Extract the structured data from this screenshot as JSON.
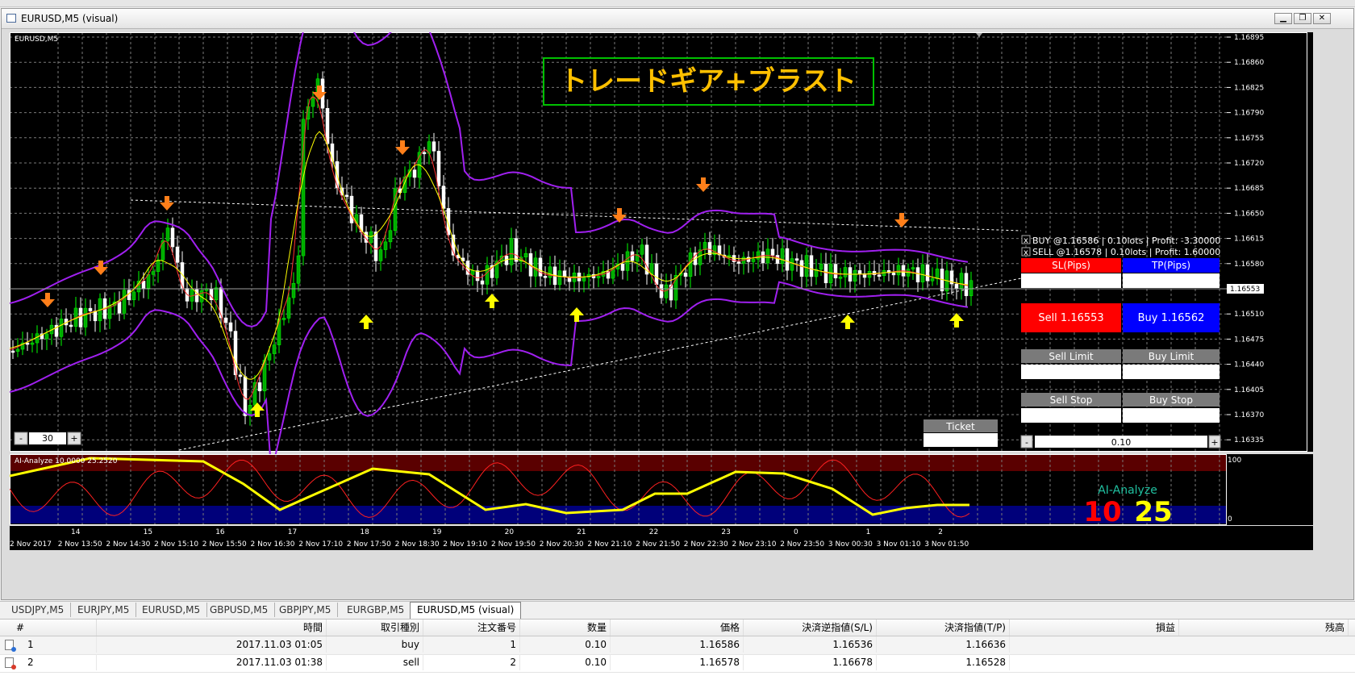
{
  "window": {
    "title": "EURUSD,M5 (visual)"
  },
  "chart": {
    "symbol_label": "EURUSD,M5",
    "banner_text": "トレードギア+ブラスト",
    "current_price_label": "1.16553",
    "price_labels": [
      "1.16895",
      "1.16860",
      "1.16825",
      "1.16790",
      "1.16755",
      "1.16720",
      "1.16685",
      "1.16650",
      "1.16615",
      "1.16580",
      "1.16545",
      "1.16510",
      "1.16475",
      "1.16440",
      "1.16405",
      "1.16370",
      "1.16335"
    ],
    "time_labels": [
      "2 Nov 2017",
      "2 Nov 13:50",
      "2 Nov 14:30",
      "2 Nov 15:10",
      "2 Nov 15:50",
      "2 Nov 16:30",
      "2 Nov 17:10",
      "2 Nov 17:50",
      "2 Nov 18:30",
      "2 Nov 19:10",
      "2 Nov 19:50",
      "2 Nov 20:30",
      "2 Nov 21:10",
      "2 Nov 21:50",
      "2 Nov 22:30",
      "2 Nov 23:10",
      "2 Nov 23:50",
      "3 Nov 00:30",
      "3 Nov 01:10",
      "3 Nov 01:50"
    ],
    "hour_labels": [
      "14",
      "15",
      "16",
      "17",
      "18",
      "19",
      "20",
      "21",
      "22",
      "23",
      "0",
      "1",
      "2"
    ],
    "colors": {
      "background": "#000000",
      "grid": "#8a8a8a",
      "bull": "#00ff00",
      "bear": "#ffffff",
      "bollinger": "#a020f0",
      "ma_fast": "#ff3030",
      "ma_slow": "#ffff00",
      "arrow_down": "#ff7f1a",
      "arrow_up": "#ffff00",
      "banner_border": "#00c000",
      "banner_text": "#ffc000"
    },
    "positions_overlay": [
      {
        "close_label": "x",
        "text": "BUY @1.16586 | 0.10lots | Profit: -3.30000"
      },
      {
        "close_label": "x",
        "text": "SELL @1.16578 | 0.10lots | Profit: 1.60000"
      }
    ],
    "stepper": {
      "minus": "-",
      "value": "30",
      "plus": "+"
    },
    "ticket_label": "Ticket"
  },
  "panel": {
    "sl_label": "SL(Pips)",
    "tp_label": "TP(Pips)",
    "sell_label": "Sell 1.16553",
    "buy_label": "Buy 1.16562",
    "sell_limit_label": "Sell Limit",
    "buy_limit_label": "Buy Limit",
    "sell_stop_label": "Sell Stop",
    "buy_stop_label": "Buy Stop",
    "lot_minus": "-",
    "lot_value": "0.10",
    "lot_plus": "+"
  },
  "indicator": {
    "label": "AI-Analyze 10.0000 25.2520",
    "title": "AI-Analyze",
    "value_red": "10",
    "value_yellow": "25",
    "axis_top": "100",
    "axis_bottom": "0",
    "colors": {
      "top_zone": "#5a0000",
      "bottom_zone": "#00007a",
      "line_fast": "#ff2020",
      "line_slow": "#ffff00",
      "value_red": "#ff0000",
      "value_yellow": "#ffff00",
      "title": "#20c0a0"
    }
  },
  "tabs": [
    "USDJPY,M5",
    "EURJPY,M5",
    "EURUSD,M5",
    "GBPUSD,M5",
    "GBPJPY,M5",
    "EURGBP,M5",
    "EURUSD,M5 (visual)"
  ],
  "active_tab": 6,
  "orders_table": {
    "headers": [
      "#",
      "時間",
      "取引種別",
      "注文番号",
      "数量",
      "価格",
      "決済逆指値(S/L)",
      "決済指値(T/P)",
      "損益",
      "残高"
    ],
    "rows": [
      {
        "id": "1",
        "time": "2017.11.03 01:05",
        "type": "buy",
        "order": "1",
        "volume": "0.10",
        "price": "1.16586",
        "sl": "1.16536",
        "tp": "1.16636"
      },
      {
        "id": "2",
        "time": "2017.11.03 01:38",
        "type": "sell",
        "order": "2",
        "volume": "0.10",
        "price": "1.16578",
        "sl": "1.16678",
        "tp": "1.16528"
      }
    ]
  }
}
